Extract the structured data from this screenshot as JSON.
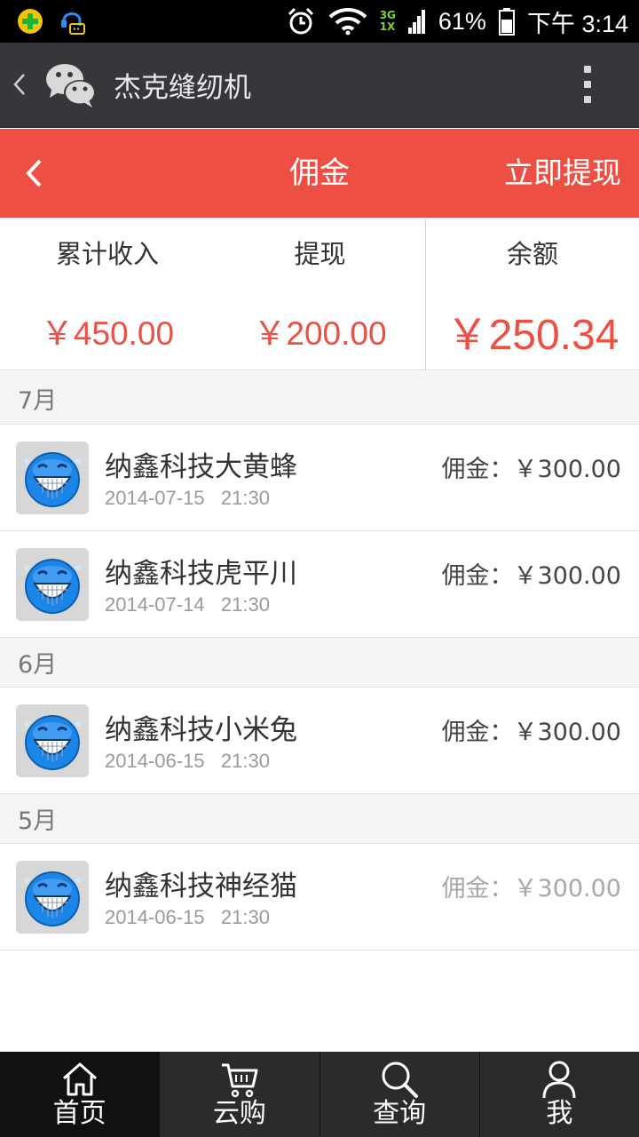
{
  "status_bar": {
    "network_top": "3G",
    "network_bottom": "1X",
    "battery": "61%",
    "time": "下午 3:14"
  },
  "wechat_header": {
    "title": "杰克缝纫机"
  },
  "page_header": {
    "title": "佣金",
    "action": "立即提现"
  },
  "summary": {
    "total_income_label": "累计收入",
    "total_income_value": "￥450.00",
    "withdrawn_label": "提现",
    "withdrawn_value": "￥200.00",
    "balance_label": "余额",
    "balance_value": "￥250.34"
  },
  "groups": [
    {
      "month": "7月",
      "items": [
        {
          "name": "纳鑫科技大黄蜂",
          "date": "2014-07-15",
          "time": "21:30",
          "amount": "佣金：￥300.00"
        },
        {
          "name": "纳鑫科技虎平川",
          "date": "2014-07-14",
          "time": "21:30",
          "amount": "佣金：￥300.00"
        }
      ]
    },
    {
      "month": "6月",
      "items": [
        {
          "name": "纳鑫科技小米兔",
          "date": "2014-06-15",
          "time": "21:30",
          "amount": "佣金：￥300.00"
        }
      ]
    },
    {
      "month": "5月",
      "items": [
        {
          "name": "纳鑫科技神经猫",
          "date": "2014-06-15",
          "time": "21:30",
          "amount": "佣金：￥300.00"
        }
      ]
    }
  ],
  "bottom_nav": [
    {
      "label": "首页",
      "icon": "home-icon"
    },
    {
      "label": "云购",
      "icon": "cart-icon"
    },
    {
      "label": "查询",
      "icon": "search-icon"
    },
    {
      "label": "我",
      "icon": "user-icon"
    }
  ],
  "colors": {
    "accent_red": "#ee4f43",
    "wechat_bar": "#35373b",
    "nav_bar": "#2b2b2b"
  }
}
